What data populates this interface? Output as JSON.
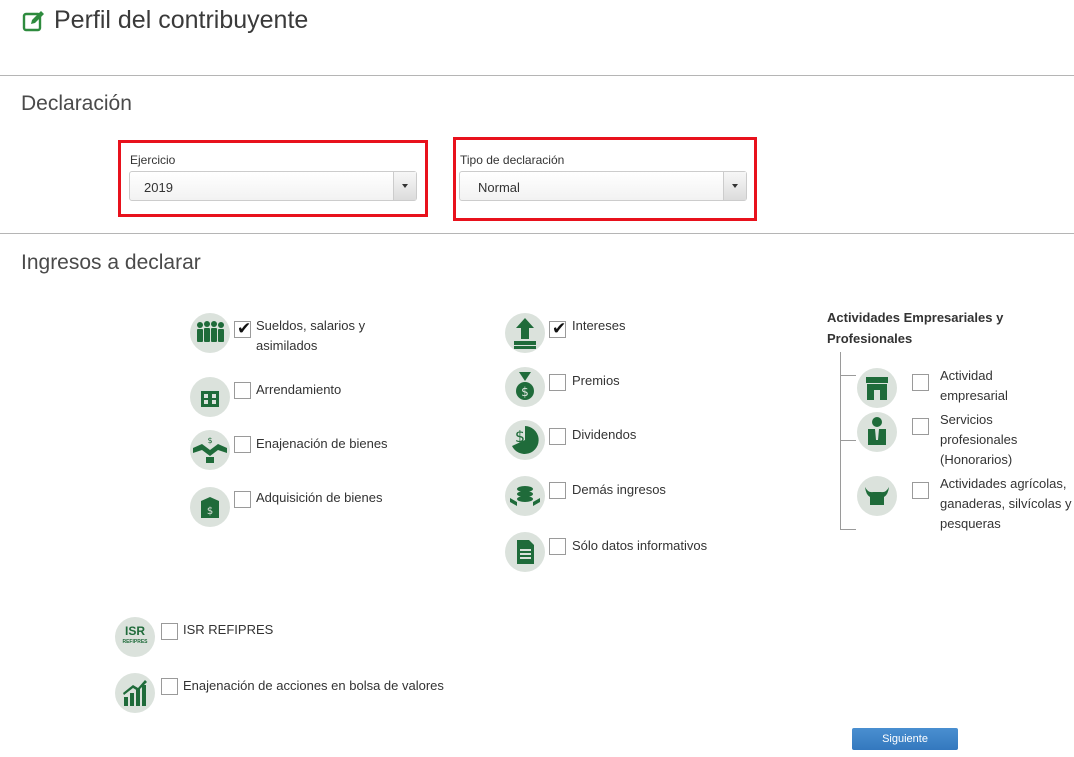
{
  "page": {
    "title": "Perfil del contribuyente"
  },
  "declaracion": {
    "heading": "Declaración",
    "ejercicio": {
      "label": "Ejercicio",
      "value": "2019"
    },
    "tipo": {
      "label": "Tipo de declaración",
      "value": "Normal"
    }
  },
  "ingresos": {
    "heading": "Ingresos a declarar",
    "col1": [
      {
        "icon": "workers-icon",
        "label": "Sueldos, salarios y asimilados",
        "checked": true
      },
      {
        "icon": "building-icon",
        "label": "Arrendamiento",
        "checked": false
      },
      {
        "icon": "handshake-icon",
        "label": "Enajenación de bienes",
        "checked": false
      },
      {
        "icon": "money-box-icon",
        "label": "Adquisición de bienes",
        "checked": false
      }
    ],
    "col2": [
      {
        "icon": "interest-arrow-icon",
        "label": "Intereses",
        "checked": true
      },
      {
        "icon": "medal-icon",
        "label": "Premios",
        "checked": false
      },
      {
        "icon": "dividend-pie-icon",
        "label": "Dividendos",
        "checked": false
      },
      {
        "icon": "coins-icon",
        "label": "Demás ingresos",
        "checked": false
      },
      {
        "icon": "document-icon",
        "label": "Sólo datos informativos",
        "checked": false
      }
    ],
    "actividades": {
      "title": "Actividades Empresariales y Profesionales",
      "items": [
        {
          "icon": "store-icon",
          "label": "Actividad empresarial",
          "checked": false
        },
        {
          "icon": "professional-icon",
          "label": "Servicios profesionales (Honorarios)",
          "checked": false
        },
        {
          "icon": "bull-icon",
          "label": "Actividades agrícolas, ganaderas, silvícolas y pesqueras",
          "checked": false
        }
      ]
    },
    "extra": [
      {
        "icon": "isr-refipres-icon",
        "icon_text": "ISR",
        "icon_subtext": "REFIPRES",
        "label": "ISR REFIPRES",
        "checked": false
      },
      {
        "icon": "stock-chart-icon",
        "label": "Enajenación de acciones en bolsa de valores",
        "checked": false
      }
    ]
  },
  "actions": {
    "next": "Siguiente"
  },
  "colors": {
    "icon_green": "#1f6b3a",
    "icon_bg": "#dbe2dc",
    "highlight": "#e8111c",
    "button": "#3a7fc4"
  }
}
